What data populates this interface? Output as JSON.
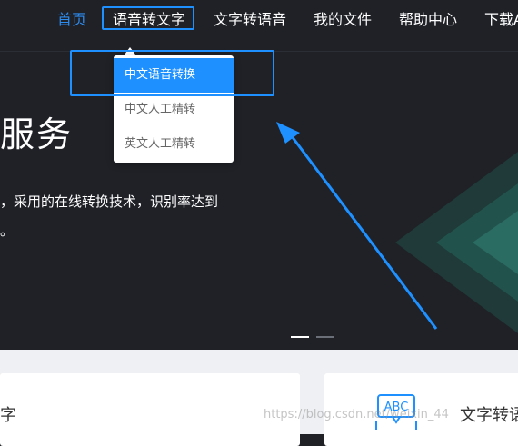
{
  "nav": {
    "items": [
      {
        "label": "首页"
      },
      {
        "label": "语音转文字"
      },
      {
        "label": "文字转语音"
      },
      {
        "label": "我的文件"
      },
      {
        "label": "帮助中心"
      },
      {
        "label": "下载A"
      }
    ]
  },
  "dropdown": {
    "items": [
      {
        "label": "中文语音转换"
      },
      {
        "label": "中文人工精转"
      },
      {
        "label": "英文人工精转"
      }
    ]
  },
  "hero": {
    "title": "服务",
    "description": "，采用的在线转换技术，识别率达到",
    "description2": "。"
  },
  "cards": [
    {
      "title": "字"
    },
    {
      "title": "文字转语",
      "icon_text": "ABC"
    }
  ],
  "watermark": "https://blog.csdn.net/weixin_44",
  "colors": {
    "accent": "#1e90ff",
    "active_nav": "#2d8cf0",
    "background": "#1f2127"
  }
}
